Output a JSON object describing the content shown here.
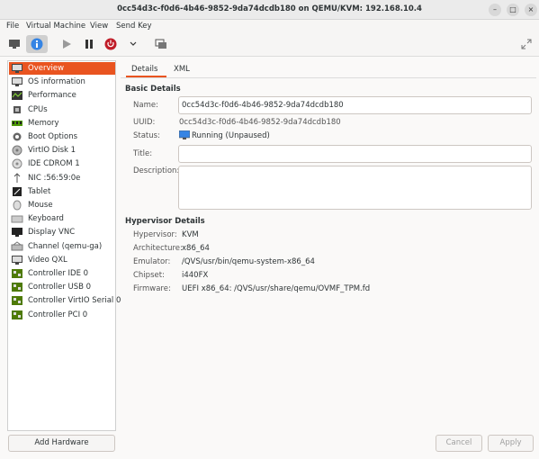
{
  "window": {
    "title": "0cc54d3c-f0d6-4b46-9852-9da74dcdb180 on QEMU/KVM: 192.168.10.4"
  },
  "menu": [
    "File",
    "Virtual Machine",
    "View",
    "Send Key"
  ],
  "sidebar": {
    "items": [
      {
        "label": "Overview",
        "icon": "monitor-icon"
      },
      {
        "label": "OS information",
        "icon": "monitor-icon"
      },
      {
        "label": "Performance",
        "icon": "chart-icon"
      },
      {
        "label": "CPUs",
        "icon": "chip-icon"
      },
      {
        "label": "Memory",
        "icon": "ram-icon"
      },
      {
        "label": "Boot Options",
        "icon": "gear-icon"
      },
      {
        "label": "VirtIO Disk 1",
        "icon": "disk-icon"
      },
      {
        "label": "IDE CDROM 1",
        "icon": "cdrom-icon"
      },
      {
        "label": "NIC :56:59:0e",
        "icon": "network-icon"
      },
      {
        "label": "Tablet",
        "icon": "tablet-icon"
      },
      {
        "label": "Mouse",
        "icon": "mouse-icon"
      },
      {
        "label": "Keyboard",
        "icon": "keyboard-icon"
      },
      {
        "label": "Display VNC",
        "icon": "display-icon"
      },
      {
        "label": "Channel (qemu-ga)",
        "icon": "channel-icon"
      },
      {
        "label": "Video QXL",
        "icon": "monitor-icon"
      },
      {
        "label": "Controller IDE 0",
        "icon": "controller-icon"
      },
      {
        "label": "Controller USB 0",
        "icon": "controller-icon"
      },
      {
        "label": "Controller VirtIO Serial 0",
        "icon": "controller-icon"
      },
      {
        "label": "Controller PCI 0",
        "icon": "controller-icon"
      }
    ],
    "selected_index": 0
  },
  "buttons": {
    "add_hardware": "Add Hardware",
    "cancel": "Cancel",
    "apply": "Apply"
  },
  "tabs": [
    "Details",
    "XML"
  ],
  "basic": {
    "heading": "Basic Details",
    "name_label": "Name:",
    "name_value": "0cc54d3c-f0d6-4b46-9852-9da74dcdb180",
    "uuid_label": "UUID:",
    "uuid_value": "0cc54d3c-f0d6-4b46-9852-9da74dcdb180",
    "status_label": "Status:",
    "status_value": "Running (Unpaused)",
    "title_label": "Title:",
    "title_value": "",
    "description_label": "Description:",
    "description_value": ""
  },
  "hypervisor": {
    "heading": "Hypervisor Details",
    "rows": [
      {
        "label": "Hypervisor:",
        "value": "KVM"
      },
      {
        "label": "Architecture:",
        "value": "x86_64"
      },
      {
        "label": "Emulator:",
        "value": "/QVS/usr/bin/qemu-system-x86_64"
      },
      {
        "label": "Chipset:",
        "value": "i440FX"
      },
      {
        "label": "Firmware:",
        "value": "UEFI x86_64: /QVS/usr/share/qemu/OVMF_TPM.fd"
      }
    ]
  },
  "colors": {
    "accent": "#e95420",
    "power": "#c01c28",
    "info": "#3584e4"
  }
}
